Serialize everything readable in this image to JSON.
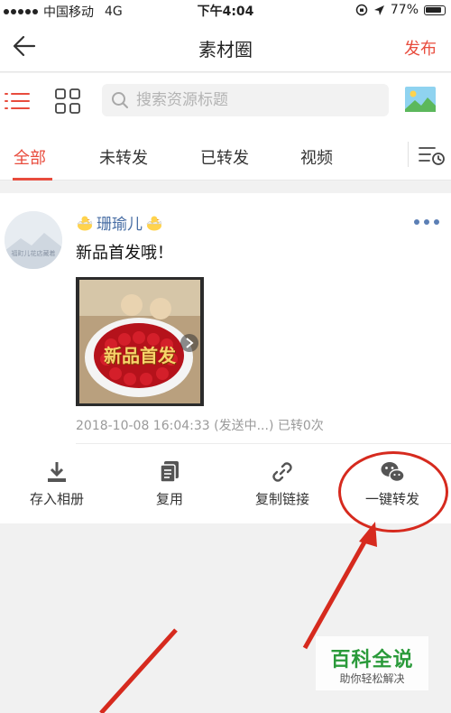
{
  "status_bar": {
    "carrier": "中国移动",
    "network": "4G",
    "time": "下午4:04",
    "battery": "77%"
  },
  "header": {
    "title": "素材圈",
    "publish_label": "发布"
  },
  "search": {
    "placeholder": "搜索资源标题"
  },
  "tabs": [
    {
      "label": "全部",
      "active": true
    },
    {
      "label": "未转发",
      "active": false
    },
    {
      "label": "已转发",
      "active": false
    },
    {
      "label": "视频",
      "active": false
    }
  ],
  "post": {
    "avatar_caption": "福町儿花店藏着",
    "username": "珊瑜儿",
    "text": "新品首发哦！",
    "image_caption": "新品首发",
    "meta": "2018-10-08 16:04:33 (发送中...) 已转0次"
  },
  "actions": [
    {
      "label": "存入相册",
      "icon": "download-icon"
    },
    {
      "label": "复用",
      "icon": "copy-icon"
    },
    {
      "label": "复制链接",
      "icon": "link-icon"
    },
    {
      "label": "一键转发",
      "icon": "wechat-icon"
    }
  ],
  "watermark": {
    "title": "百科全说",
    "subtitle": "助你轻松解决"
  },
  "colors": {
    "accent": "#e84c3d",
    "username": "#4a6fa5",
    "annotation": "#d62a1e",
    "watermark": "#2a9a3a"
  }
}
